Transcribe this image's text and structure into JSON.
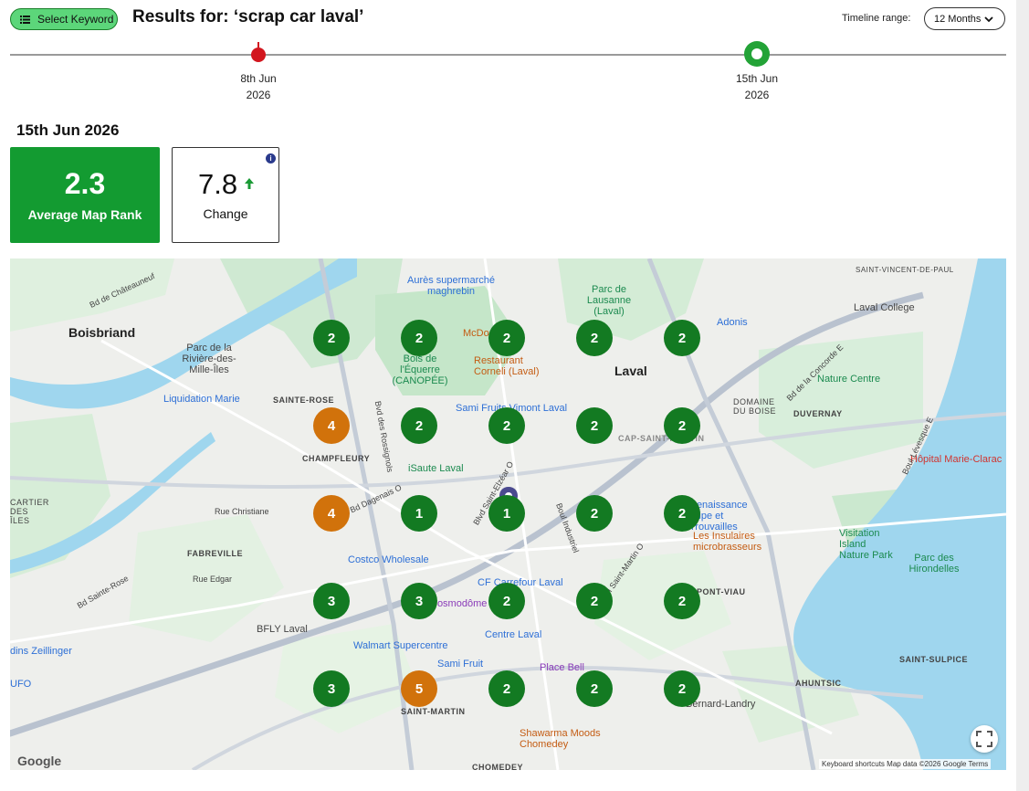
{
  "header": {
    "select_keyword_label": "Select Keyword",
    "results_title": "Results for: ‘scrap car laval’",
    "timeline_range_label": "Timeline range:",
    "timeline_range_value": "12 Months"
  },
  "timeline": {
    "points": [
      {
        "day": "8th Jun",
        "year": "2026",
        "status": "past"
      },
      {
        "day": "15th Jun",
        "year": "2026",
        "status": "selected"
      }
    ]
  },
  "summary": {
    "date_heading": "15th Jun 2026",
    "average_rank_value": "2.3",
    "average_rank_label": "Average Map Rank",
    "change_value": "7.8",
    "change_label": "Change",
    "change_direction": "up",
    "info_icon": "i"
  },
  "colors": {
    "rank_green": "#137a22",
    "rank_orange": "#d1720b",
    "card_green": "#139b31",
    "timeline_past": "#d2161e",
    "timeline_selected": "#23a337"
  },
  "map": {
    "grid_ranks": [
      [
        "2",
        "2",
        "2",
        "2",
        "2"
      ],
      [
        "4",
        "2",
        "2",
        "2",
        "2"
      ],
      [
        "4",
        "1",
        "1",
        "2",
        "2"
      ],
      [
        "3",
        "3",
        "2",
        "2",
        "2"
      ],
      [
        "3",
        "5",
        "2",
        "2",
        "2"
      ]
    ],
    "labels": {
      "boisbriand": "Boisbriand",
      "parc_riviere": "Parc de la Rivière-des-Mille-Îles",
      "sainte_rose": "SAINTE-ROSE",
      "liquidation": "Liquidation Marie",
      "champfleury": "CHAMPFLEURY",
      "fabreville": "FABREVILLE",
      "laval": "Laval",
      "duvernay": "DUVERNAY",
      "auclair": "CAP-SAINT-MARTIN",
      "bois_equerre": "Bois de l'Équerre (CANOPÉE)",
      "aures": "Aurès supermarché maghrebin",
      "parc_lausanne": "Parc de Lausanne (Laval)",
      "adonis": "Adonis",
      "laval_college": "Laval College",
      "nature_centre": "Nature Centre",
      "domaine_bois": "DOMAINE DU BOISE",
      "restaurant_corneli": "Restaurant Corneli (Laval)",
      "mcdo": "McDo",
      "sami_vimont": "Sami Fruits Vimont Laval",
      "isaute": "iSaute Laval",
      "costco": "Costco Wholesale",
      "carrefour": "CF Carrefour Laval",
      "cosmodome": "Cosmodôme",
      "centre_laval": "Centre Laval",
      "walmart": "Walmart Supercentre",
      "sami_fruit": "Sami Fruit",
      "place_bell": "Place Bell",
      "insulaires": "Les Insulaires microbrasseurs",
      "renaissance": "Renaissance Fripe et Trouvailles",
      "visitation": "Visitation Island Nature Park",
      "parc_hirondelles": "Parc des Hirondelles",
      "pont_viau": "PONT-VIAU",
      "saint_martin": "SAINT-MARTIN",
      "ahuntsic": "AHUNTSIC",
      "saint_sulpice": "SAINT-SULPICE",
      "hopital": "Hôpital Marie-Clarac",
      "shawarma": "Shawarma Moods Chomedey",
      "chomedey": "CHOMEDEY",
      "bfly": "BFLY Laval",
      "zeillinger": "dins Zeillinger",
      "ufo": "UFO",
      "saint_vincent": "SAINT-VINCENT-DE-PAUL",
      "cartier": "CARTIER DES ÎLES",
      "bernard": "Bernard-Landry"
    },
    "streets": {
      "chateauneuf": "Bd de Châteauneuf",
      "sainte_rose_bd": "Bd Sainte-Rose",
      "rossignols": "Bvd des Rossignols",
      "dagenais": "Bd Dagenais O",
      "christiane": "Rue Christiane",
      "edgar": "Rue Edgar",
      "industriel": "Boul Industriel",
      "saint_elzear": "Blvd Saint-Elzéar O",
      "saint_martin_o": "Boul Saint-Martin O",
      "levesque": "Boul Lévesque E",
      "concorde": "Bd de la Concorde E"
    },
    "google": "Google",
    "footer": "Keyboard shortcuts  Map data ©2026 Google  Terms"
  }
}
